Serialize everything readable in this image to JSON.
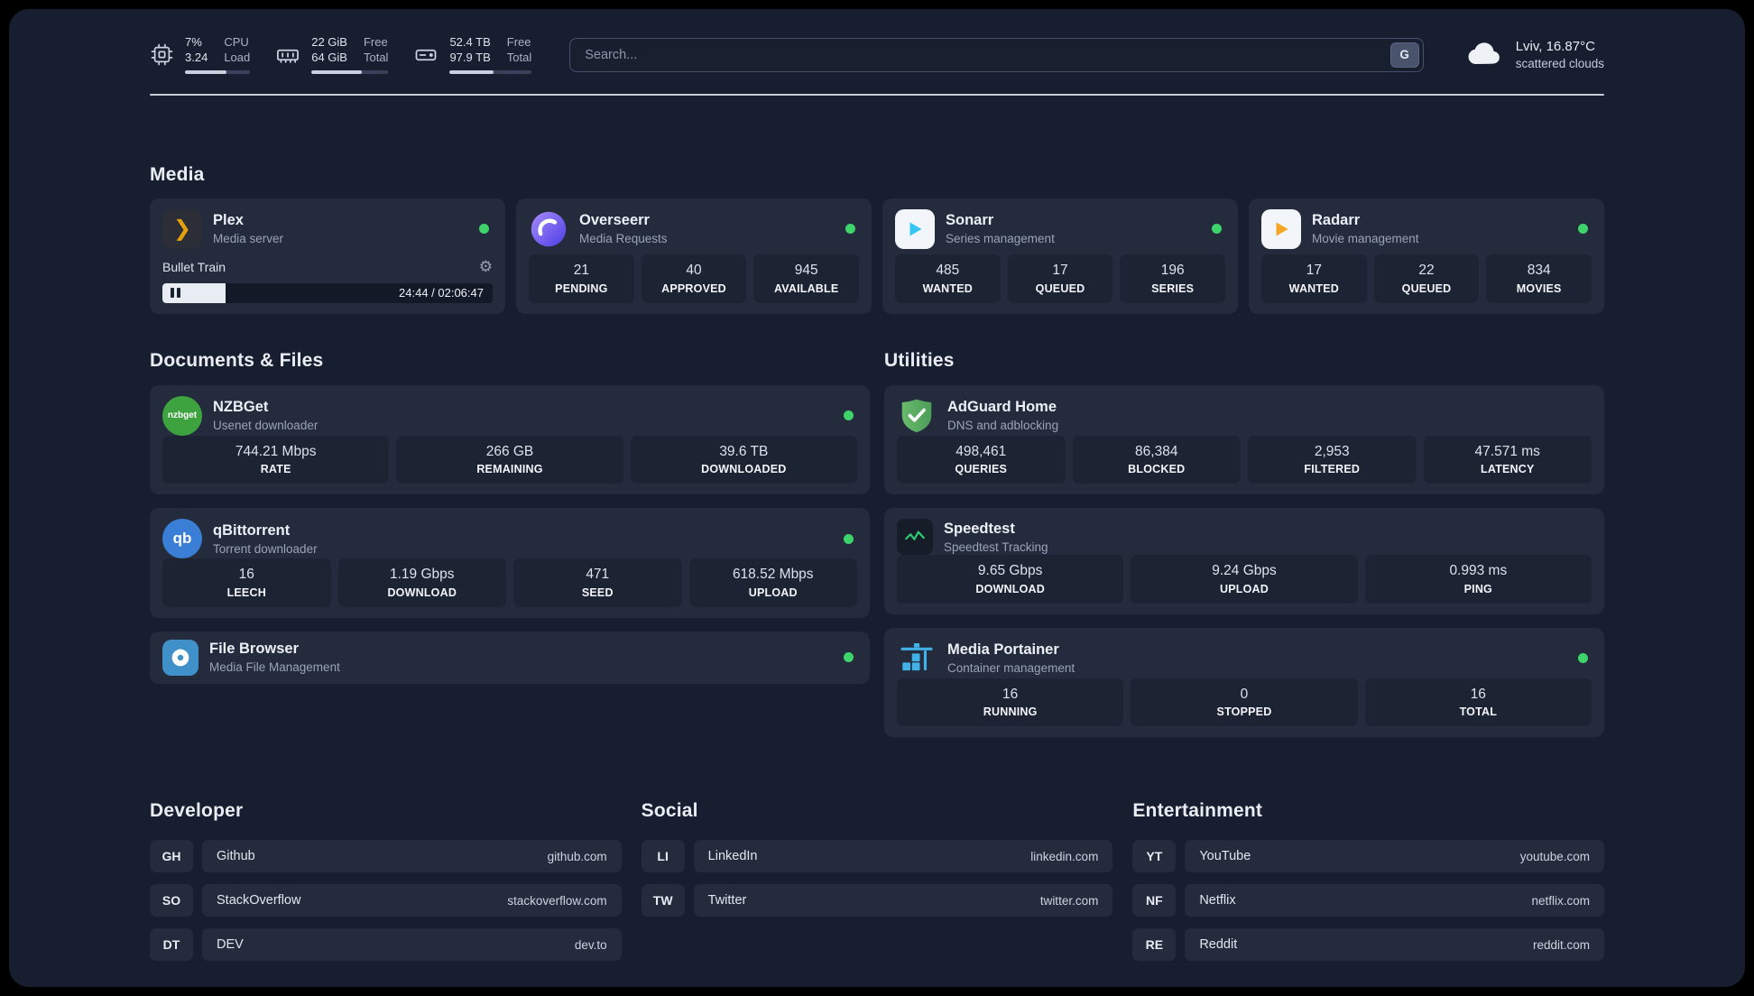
{
  "theme": {
    "status_online": "#3ed46c",
    "plex_gold": "#e5a00d"
  },
  "icons": {
    "plex_glyph": "❯",
    "gear_glyph": "⚙",
    "nzbget_label": "nzbget",
    "qbittorrent_label": "qb"
  },
  "topbar": {
    "cpu": {
      "value_top": "7%",
      "value_bottom": "3.24",
      "label_top": "CPU",
      "label_bottom": "Load",
      "progress_pct": 64
    },
    "ram": {
      "value_top": "22 GiB",
      "value_bottom": "64 GiB",
      "label_top": "Free",
      "label_bottom": "Total",
      "progress_pct": 66
    },
    "disk": {
      "value_top": "52.4 TB",
      "value_bottom": "97.9 TB",
      "label_top": "Free",
      "label_bottom": "Total",
      "progress_pct": 54
    },
    "search": {
      "placeholder": "Search...",
      "button_label": "G"
    },
    "weather": {
      "location": "Lviv, 16.87°C",
      "condition": "scattered clouds"
    }
  },
  "media": {
    "title": "Media",
    "plex": {
      "name": "Plex",
      "subtitle": "Media server",
      "now_playing": "Bullet Train",
      "time": "24:44 / 02:06:47",
      "progress_pct": 19
    },
    "overseerr": {
      "name": "Overseerr",
      "subtitle": "Media Requests",
      "stats": [
        {
          "value": "21",
          "label": "PENDING"
        },
        {
          "value": "40",
          "label": "APPROVED"
        },
        {
          "value": "945",
          "label": "AVAILABLE"
        }
      ]
    },
    "sonarr": {
      "name": "Sonarr",
      "subtitle": "Series management",
      "stats": [
        {
          "value": "485",
          "label": "WANTED"
        },
        {
          "value": "17",
          "label": "QUEUED"
        },
        {
          "value": "196",
          "label": "SERIES"
        }
      ]
    },
    "radarr": {
      "name": "Radarr",
      "subtitle": "Movie management",
      "stats": [
        {
          "value": "17",
          "label": "WANTED"
        },
        {
          "value": "22",
          "label": "QUEUED"
        },
        {
          "value": "834",
          "label": "MOVIES"
        }
      ]
    }
  },
  "documents": {
    "title": "Documents & Files",
    "nzbget": {
      "name": "NZBGet",
      "subtitle": "Usenet downloader",
      "stats": [
        {
          "value": "744.21 Mbps",
          "label": "RATE"
        },
        {
          "value": "266 GB",
          "label": "REMAINING"
        },
        {
          "value": "39.6 TB",
          "label": "DOWNLOADED"
        }
      ]
    },
    "qbittorrent": {
      "name": "qBittorrent",
      "subtitle": "Torrent downloader",
      "stats": [
        {
          "value": "16",
          "label": "LEECH"
        },
        {
          "value": "1.19 Gbps",
          "label": "DOWNLOAD"
        },
        {
          "value": "471",
          "label": "SEED"
        },
        {
          "value": "618.52 Mbps",
          "label": "UPLOAD"
        }
      ]
    },
    "filebrowser": {
      "name": "File Browser",
      "subtitle": "Media File Management"
    }
  },
  "utilities": {
    "title": "Utilities",
    "adguard": {
      "name": "AdGuard Home",
      "subtitle": "DNS and adblocking",
      "stats": [
        {
          "value": "498,461",
          "label": "QUERIES"
        },
        {
          "value": "86,384",
          "label": "BLOCKED"
        },
        {
          "value": "2,953",
          "label": "FILTERED"
        },
        {
          "value": "47.571 ms",
          "label": "LATENCY"
        }
      ]
    },
    "speedtest": {
      "name": "Speedtest",
      "subtitle": "Speedtest Tracking",
      "stats": [
        {
          "value": "9.65 Gbps",
          "label": "DOWNLOAD"
        },
        {
          "value": "9.24 Gbps",
          "label": "UPLOAD"
        },
        {
          "value": "0.993 ms",
          "label": "PING"
        }
      ]
    },
    "portainer": {
      "name": "Media Portainer",
      "subtitle": "Container management",
      "stats": [
        {
          "value": "16",
          "label": "RUNNING"
        },
        {
          "value": "0",
          "label": "STOPPED"
        },
        {
          "value": "16",
          "label": "TOTAL"
        }
      ]
    }
  },
  "bookmarks": {
    "developer": {
      "title": "Developer",
      "items": [
        {
          "abbr": "GH",
          "name": "Github",
          "url": "github.com"
        },
        {
          "abbr": "SO",
          "name": "StackOverflow",
          "url": "stackoverflow.com"
        },
        {
          "abbr": "DT",
          "name": "DEV",
          "url": "dev.to"
        }
      ]
    },
    "social": {
      "title": "Social",
      "items": [
        {
          "abbr": "LI",
          "name": "LinkedIn",
          "url": "linkedin.com"
        },
        {
          "abbr": "TW",
          "name": "Twitter",
          "url": "twitter.com"
        }
      ]
    },
    "entertainment": {
      "title": "Entertainment",
      "items": [
        {
          "abbr": "YT",
          "name": "YouTube",
          "url": "youtube.com"
        },
        {
          "abbr": "NF",
          "name": "Netflix",
          "url": "netflix.com"
        },
        {
          "abbr": "RE",
          "name": "Reddit",
          "url": "reddit.com"
        }
      ]
    }
  }
}
